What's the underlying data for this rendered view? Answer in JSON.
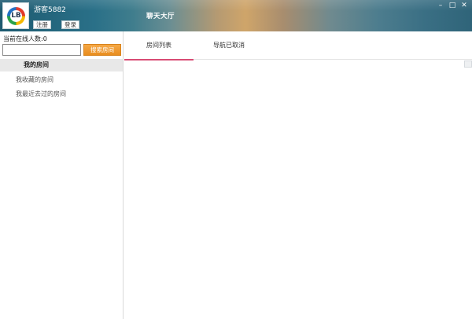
{
  "header": {
    "avatar_text": "LB",
    "username": "游客5882",
    "register_label": "注册",
    "login_label": "登录",
    "app_title": "聊天大厅"
  },
  "window_controls": {
    "minimize": "–",
    "maximize": "□",
    "close": "✕"
  },
  "sidebar": {
    "online_count": "当前在线人数:0",
    "search_input_value": "",
    "search_button_label": "搜索房间",
    "my_rooms_label": "我的房间",
    "items": [
      {
        "label": "我收藏的房间"
      },
      {
        "label": "我最近去过的房间"
      }
    ]
  },
  "main": {
    "tabs": [
      {
        "label": "房间列表",
        "active": true
      },
      {
        "label": "导航已取消",
        "active": false
      }
    ]
  },
  "colors": {
    "tab_underline": "#d84c74",
    "search_button": "#e88d1e"
  }
}
